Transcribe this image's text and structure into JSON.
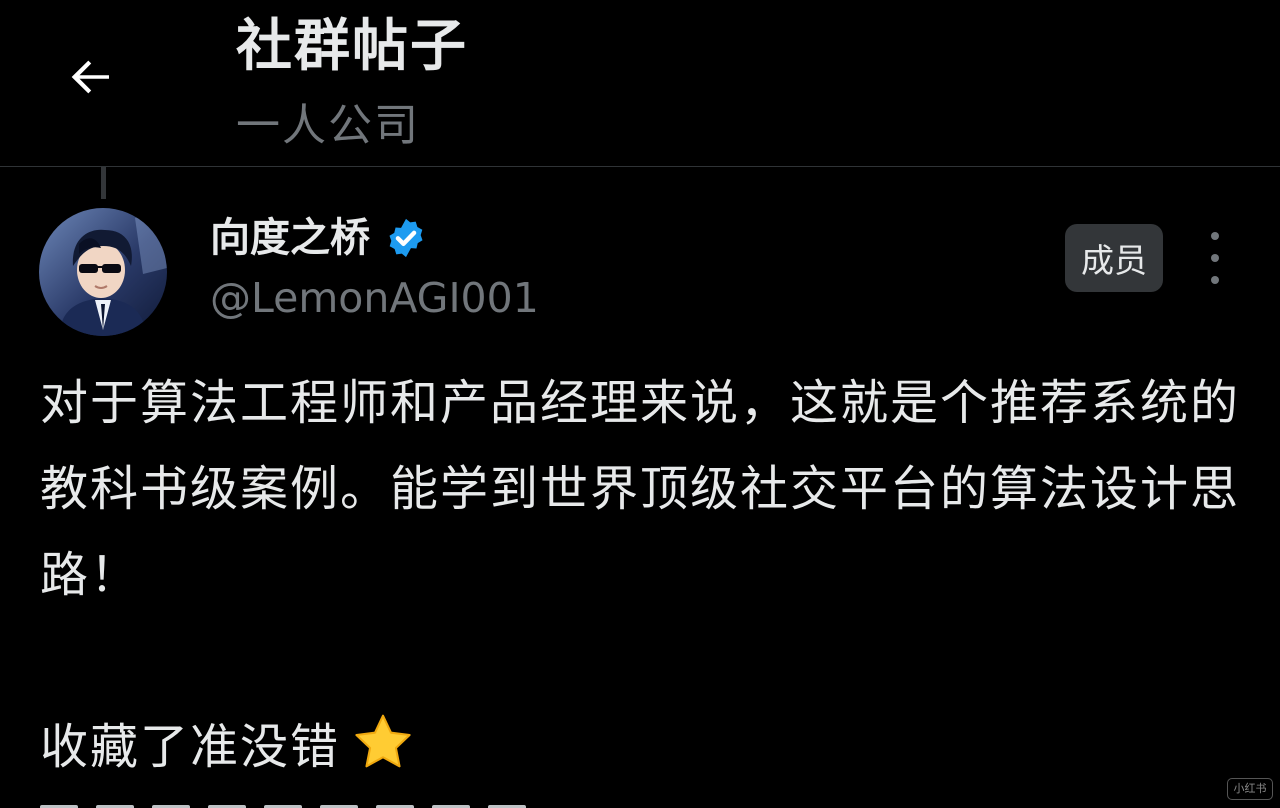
{
  "header": {
    "title": "社群帖子",
    "subtitle": "一人公司",
    "back_icon": "arrow-left-icon"
  },
  "post": {
    "author": {
      "display_name": "向度之桥",
      "handle": "@LemonAGI001",
      "verified": true,
      "verified_color": "#1d9bf0",
      "avatar_icon": "avatar-image"
    },
    "member_badge": "成员",
    "more_icon": "more-vertical-icon",
    "paragraphs": [
      "对于算法工程师和产品经理来说，这就是个推荐系统的教科书级案例。能学到世界顶级社交平台的算法设计思路！",
      "收藏了准没错"
    ],
    "emoji": "star-emoji"
  },
  "watermark": "小红书",
  "colors": {
    "background": "#000000",
    "primary_text": "#e7e9ea",
    "secondary_text": "#71767b",
    "badge_background": "#333639",
    "divider": "#2f3336",
    "verified_blue": "#1d9bf0",
    "star_yellow": "#ffcc33"
  }
}
